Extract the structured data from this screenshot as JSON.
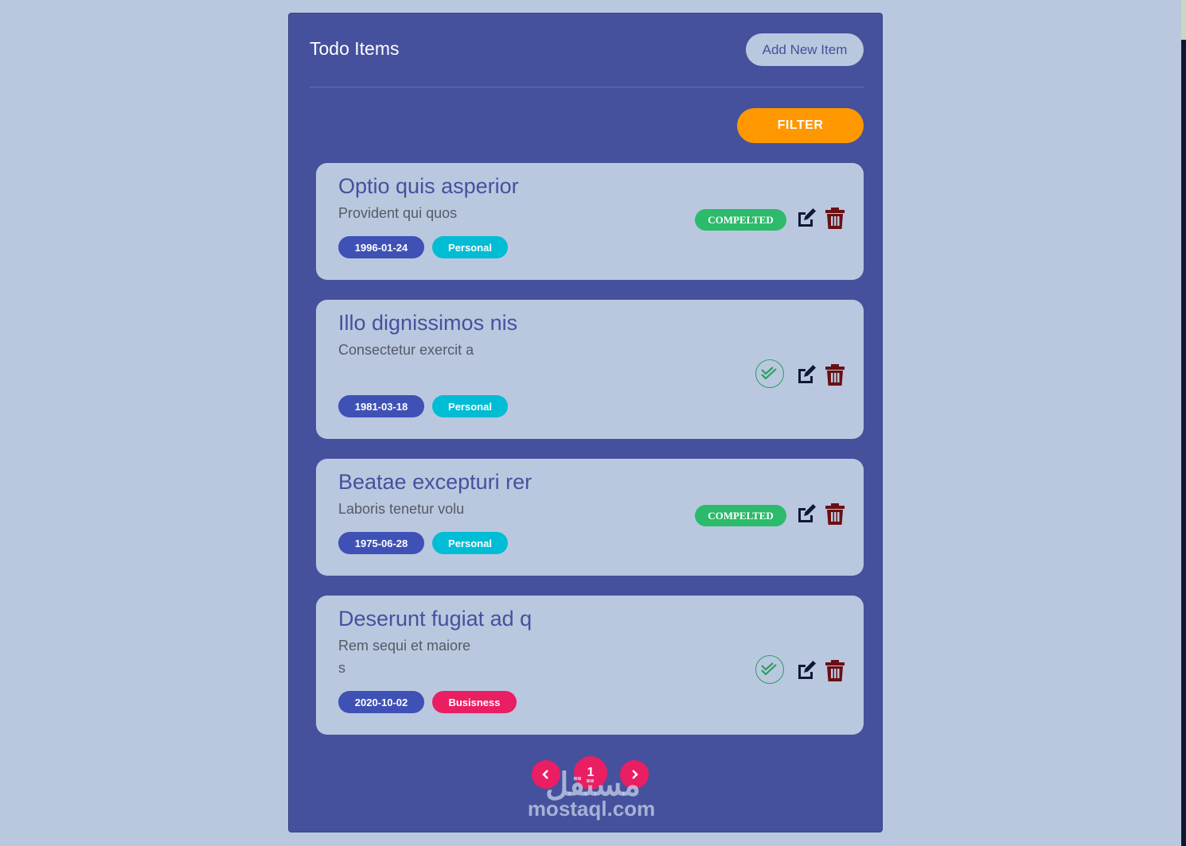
{
  "header": {
    "title": "Todo Items",
    "add_button": "Add New Item"
  },
  "filter_button": "FILTER",
  "todos": [
    {
      "title": "Optio quis asperior",
      "description": "Provident qui quos",
      "date": "1996-01-24",
      "category": "Personal",
      "category_color": "#00bcd4",
      "status": "COMPELTED",
      "completed": true
    },
    {
      "title": "Illo dignissimos nis",
      "description": "Consectetur exercit a",
      "date": "1981-03-18",
      "category": "Personal",
      "category_color": "#00bcd4",
      "status": "",
      "completed": false
    },
    {
      "title": "Beatae excepturi rer",
      "description": "Laboris tenetur volu",
      "date": "1975-06-28",
      "category": "Personal",
      "category_color": "#00bcd4",
      "status": "COMPELTED",
      "completed": true
    },
    {
      "title": "Deserunt fugiat ad q",
      "description": "Rem sequi et maiore s",
      "date": "2020-10-02",
      "category": "Busisness",
      "category_color": "#e91e63",
      "status": "",
      "completed": false
    }
  ],
  "pagination": {
    "current_page": "1",
    "prev_icon": "chevron-left-icon",
    "next_icon": "chevron-right-icon"
  },
  "watermark": {
    "logo_text": "مستقل",
    "site": "mostaql.com"
  },
  "colors": {
    "background": "#b9c8df",
    "panel": "#45519c",
    "filter": "#ff9800",
    "completed": "#2bbb6a",
    "date_badge": "#3f51b5",
    "trash": "#6b0f14",
    "pager": "#e91e63"
  }
}
